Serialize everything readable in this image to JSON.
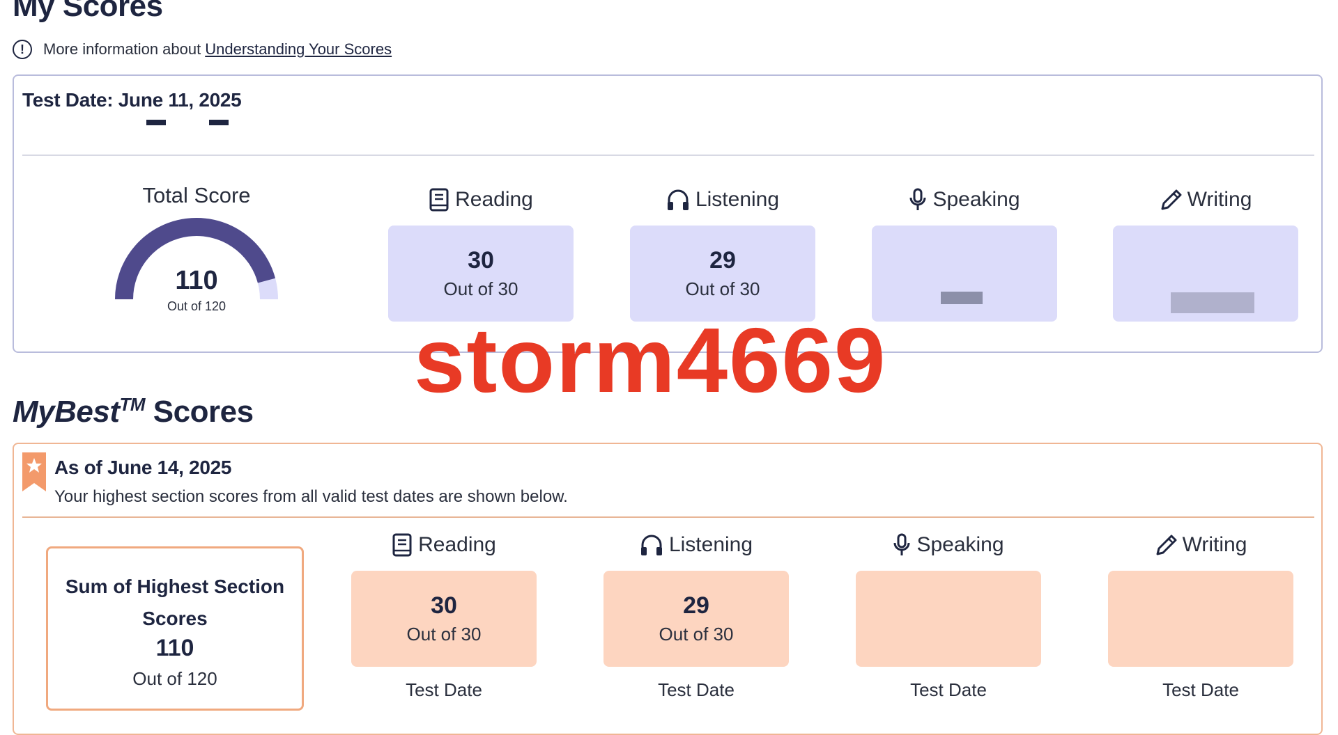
{
  "header": {
    "title": "My Scores",
    "info_prefix": "More information about",
    "info_link": "Understanding Your Scores"
  },
  "latest": {
    "test_date": "Test Date: June 11, 2025",
    "total": {
      "label": "Total Score",
      "value": "110",
      "out_of": "Out of 120",
      "fraction": 0.9167
    },
    "sections": [
      {
        "name": "Reading",
        "icon": "book-icon",
        "value": "30",
        "out_of": "Out of 30"
      },
      {
        "name": "Listening",
        "icon": "headphones-icon",
        "value": "29",
        "out_of": "Out of 30"
      },
      {
        "name": "Speaking",
        "icon": "microphone-icon",
        "value": "",
        "out_of": ""
      },
      {
        "name": "Writing",
        "icon": "pencil-icon",
        "value": "",
        "out_of": ""
      }
    ]
  },
  "mybest": {
    "title_italic": "MyBest",
    "title_tm": "TM",
    "title_rest": "Scores",
    "as_of": "As of June 14, 2025",
    "description": "Your highest section scores from all valid test dates are shown below.",
    "sum": {
      "label_line1": "Sum of Highest Section",
      "label_line2": "Scores",
      "value": "110",
      "out_of": "Out of 120"
    },
    "sections": [
      {
        "name": "Reading",
        "icon": "book-icon",
        "value": "30",
        "out_of": "Out of 30",
        "test_date_label": "Test Date",
        "test_date": ""
      },
      {
        "name": "Listening",
        "icon": "headphones-icon",
        "value": "29",
        "out_of": "Out of 30",
        "test_date_label": "Test Date",
        "test_date": ""
      },
      {
        "name": "Speaking",
        "icon": "microphone-icon",
        "value": "",
        "out_of": "",
        "test_date_label": "Test Date",
        "test_date": ""
      },
      {
        "name": "Writing",
        "icon": "pencil-icon",
        "value": "",
        "out_of": "",
        "test_date_label": "Test Date",
        "test_date": ""
      }
    ]
  },
  "watermark": "storm4669",
  "colors": {
    "navy": "#1e2540",
    "gauge_fill": "#4f4a8c",
    "gauge_track": "#dcdcfa",
    "purple_box": "#dcdcfa",
    "peach_box": "#fdd5c0",
    "peach_border": "#f0a97f",
    "ribbon": "#f39a6b",
    "watermark": "#e83a25"
  }
}
